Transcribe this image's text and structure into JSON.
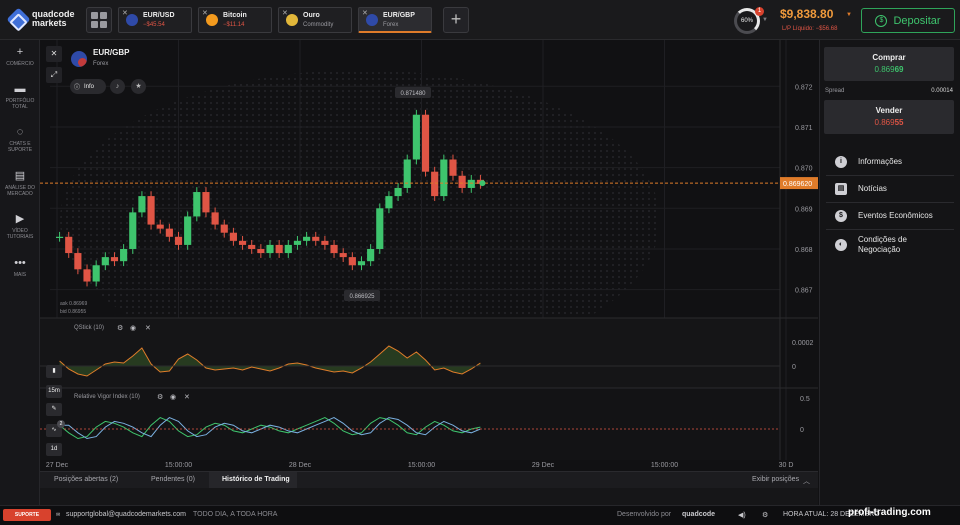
{
  "brand": {
    "line1": "quadcode",
    "line2": "markets"
  },
  "tabs": [
    {
      "name": "EUR/USD",
      "sub": "−$45.54",
      "sub_color": "#e05545",
      "icon_color": "#2f4aa8",
      "active": false
    },
    {
      "name": "Bitcoin",
      "sub": "−$11.14",
      "sub_color": "#e05545",
      "icon_color": "#f39a1e",
      "active": false
    },
    {
      "name": "Ouro",
      "sub": "Commodity",
      "sub_color": "#9a9aa0",
      "icon_color": "#e2b73a",
      "active": false
    },
    {
      "name": "EUR/GBP",
      "sub": "Forex",
      "sub_color": "#9a9aa0",
      "icon_color": "#2f4aa8",
      "active": true
    }
  ],
  "header": {
    "progress": "60%",
    "notification_count": "1",
    "balance": "$9,838.80",
    "pl_label": "L/P Líquido: −$56.68",
    "deposit_label": "Depositar"
  },
  "sidebar": [
    {
      "icon": "plus-icon",
      "glyph": "+",
      "label": "COMÉRCIO"
    },
    {
      "icon": "briefcase-icon",
      "glyph": "▬",
      "label": "PORTFÓLIO TOTAL"
    },
    {
      "icon": "chat-icon",
      "glyph": "◌",
      "label": "CHATS E SUPORTE"
    },
    {
      "icon": "news-icon",
      "glyph": "▤",
      "label": "ANÁLISE DO MERCADO"
    },
    {
      "icon": "play-icon",
      "glyph": "▶",
      "label": "VÍDEO TUTORIAIS"
    },
    {
      "icon": "more-icon",
      "glyph": "•••",
      "label": "MAIS"
    }
  ],
  "asset": {
    "name": "EUR/GBP",
    "type": "Forex",
    "info_label": "Info"
  },
  "chart_data": {
    "type": "candlestick",
    "title": "EUR/GBP",
    "y_axis_ticks": [
      "0.872",
      "0.871",
      "0.870",
      "0.869",
      "0.868",
      "0.867"
    ],
    "x_axis_ticks": [
      "27 Dec",
      "15:00:00",
      "28 Dec",
      "15:00:00",
      "29 Dec",
      "15:00:00",
      "30 D"
    ],
    "current_price": "0.869620",
    "high_label": "0.871480",
    "low_label": "0.866925",
    "ask": "ask 0.86969",
    "bid": "bid 0.86955",
    "close_values": [
      0.8683,
      0.8679,
      0.8675,
      0.8672,
      0.8676,
      0.8678,
      0.8677,
      0.868,
      0.8689,
      0.8693,
      0.8686,
      0.8685,
      0.8683,
      0.8681,
      0.8688,
      0.8694,
      0.8689,
      0.8686,
      0.8684,
      0.8682,
      0.8681,
      0.868,
      0.8679,
      0.8681,
      0.8679,
      0.8681,
      0.8682,
      0.8683,
      0.8682,
      0.8681,
      0.8679,
      0.8678,
      0.8676,
      0.8677,
      0.868,
      0.869,
      0.8693,
      0.8695,
      0.8702,
      0.8713,
      0.8699,
      0.8693,
      0.8702,
      0.8698,
      0.8695,
      0.8697,
      0.8696
    ],
    "indicators": [
      {
        "name": "QStick (10)",
        "ticks": [
          "0.0002",
          "0"
        ],
        "values": [
          5e-05,
          -3e-05,
          -8e-05,
          -0.0001,
          -4e-05,
          2e-05,
          4e-05,
          3e-05,
          0.0001,
          0.00018,
          2e-05,
          -6e-05,
          -5e-05,
          7e-05,
          0.00012,
          6e-05,
          -2e-05,
          -4e-05,
          -3e-05,
          -2e-05,
          -4e-05,
          -1e-05,
          -3e-05,
          -5e-05,
          -2e-05,
          2e-05,
          3e-05,
          1e-05,
          -2e-05,
          -4e-05,
          -6e-05,
          -5e-05,
          -7e-05,
          -2e-05,
          4e-05,
          0.00012,
          0.0002,
          0.00015,
          8e-05,
          0.00014,
          6e-05,
          -4e-05,
          -2e-05,
          -6e-05,
          -8e-05,
          -3e-05,
          3e-05
        ]
      },
      {
        "name": "Relative Vigor Index (10)",
        "ticks": [
          "0.5",
          "0"
        ],
        "values": [
          0.1,
          -0.1,
          -0.25,
          -0.2,
          0.05,
          0.2,
          0.15,
          0.05,
          -0.1,
          -0.2,
          0.1,
          0.3,
          0.2,
          -0.05,
          -0.2,
          -0.15,
          0.05,
          0.15,
          0.1,
          -0.05,
          -0.1,
          0.0,
          0.1,
          0.05,
          -0.05,
          -0.1,
          0.0,
          0.1,
          0.2,
          0.3,
          0.15,
          -0.05,
          -0.15,
          -0.1,
          0.15,
          0.3,
          0.25,
          0.1,
          -0.1,
          -0.15,
          0.05,
          0.2,
          0.1,
          -0.05,
          -0.1,
          0.0,
          0.05
        ]
      }
    ]
  },
  "chart_tools": {
    "timeframe": "15m",
    "count": "1d",
    "badge": "2"
  },
  "trade": {
    "buy_label": "Comprar",
    "buy_price_main": "0.869",
    "buy_price_end": "69",
    "sell_label": "Vender",
    "sell_price_main": "0.869",
    "sell_price_end": "55",
    "spread_label": "Spread",
    "spread_value": "0.00014"
  },
  "right_menu": [
    {
      "icon": "info-icon",
      "glyph": "i",
      "label": "Informações"
    },
    {
      "icon": "news-icon",
      "glyph": "▤",
      "label": "Notícias"
    },
    {
      "icon": "dollar-icon",
      "glyph": "$",
      "label": "Eventos Econômicos"
    },
    {
      "icon": "settings-icon",
      "glyph": "◐",
      "label": "Condições de Negociação"
    }
  ],
  "bottom_tabs": {
    "open": "Posições abertas (2)",
    "pending": "Pendentes (0)",
    "history": "Histórico de Trading",
    "show": "Exibir posições"
  },
  "footer": {
    "support": "SUPORTE",
    "email": "supportglobal@quadcodemarkets.com",
    "hours": "TODO DIA, A TODA HORA",
    "dev": "Desenvolvido por",
    "dev_brand": "quadcode",
    "time_label": "HORA ATUAL: 28 DEZEMBRO",
    "watermark": "profi-trading.com"
  }
}
